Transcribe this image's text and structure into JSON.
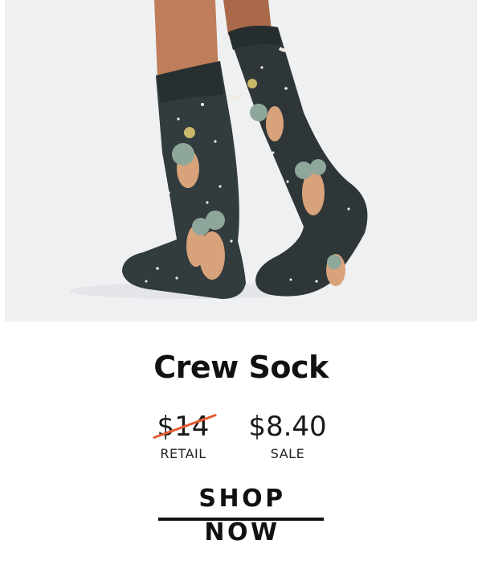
{
  "product": {
    "image_alt": "Crew sock with astronaut otters in space pattern",
    "title": "Crew Sock",
    "retail_price": "$14",
    "retail_label": "RETAIL",
    "sale_price": "$8.40",
    "sale_label": "SALE"
  },
  "cta": {
    "label": "SHOP NOW"
  },
  "colors": {
    "hero_background": "#eff0f2",
    "sock": "#2e3638",
    "strike": "#e55b30",
    "text": "#111111"
  }
}
